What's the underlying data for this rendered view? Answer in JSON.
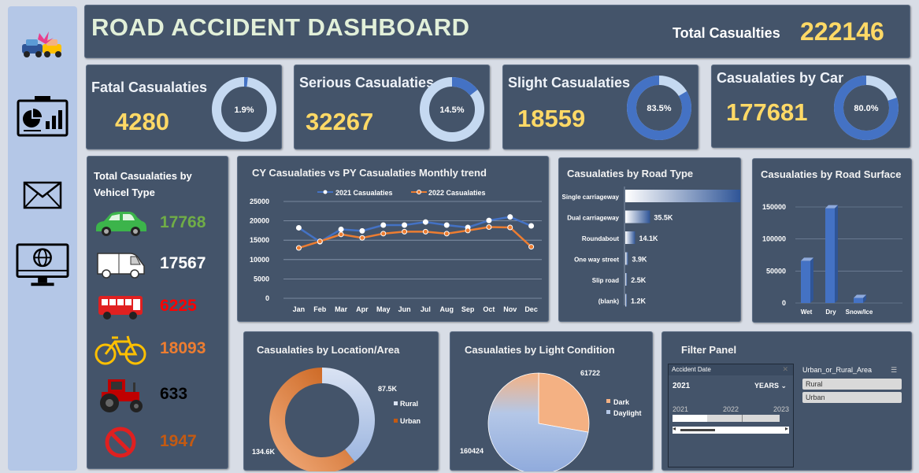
{
  "header": {
    "title": "ROAD ACCIDENT DASHBOARD",
    "total_label": "Total Casualties",
    "total_value": "222146"
  },
  "kpis": [
    {
      "label": "Fatal Casualaties",
      "value": "4280",
      "pct_label": "1.9%",
      "pct": 0.019
    },
    {
      "label": "Serious Casualaties",
      "value": "32267",
      "pct_label": "14.5%",
      "pct": 0.145
    },
    {
      "label": "Slight Casualaties",
      "value": "18559",
      "pct_label": "83.5%",
      "pct": 0.835
    },
    {
      "label": "Casualaties by Car",
      "value": "177681",
      "pct_label": "80.0%",
      "pct": 0.8
    }
  ],
  "vehicle": {
    "title": "Total Casualaties by Vehicel Type",
    "items": [
      {
        "name": "car",
        "value": "17768",
        "color": "#70ad47"
      },
      {
        "name": "van",
        "value": "17567",
        "color": "#ffffff"
      },
      {
        "name": "bus",
        "value": "6225",
        "color": "#ff0000"
      },
      {
        "name": "bicycle",
        "value": "18093",
        "color": "#ed7d31"
      },
      {
        "name": "tractor",
        "value": "633",
        "color": "#000000"
      },
      {
        "name": "other",
        "value": "1947",
        "color": "#c55a11"
      }
    ]
  },
  "trend": {
    "title": "CY Casualaties vs PY Casualaties Monthly trend",
    "legend": [
      "2021 Casualaties",
      "2022 Casualaties"
    ],
    "y_ticks": [
      "25000",
      "20000",
      "15000",
      "10000",
      "5000",
      "0"
    ],
    "months": [
      "Jan",
      "Feb",
      "Mar",
      "Apr",
      "May",
      "Jun",
      "Jul",
      "Aug",
      "Sep",
      "Oct",
      "Nov",
      "Dec"
    ]
  },
  "road_type": {
    "title": "Casualaties by Road Type",
    "rows": [
      {
        "label": "Single carriageway",
        "value": "165.0K"
      },
      {
        "label": "Dual carriageway",
        "value": "35.5K"
      },
      {
        "label": "Roundabout",
        "value": "14.1K"
      },
      {
        "label": "One way street",
        "value": "3.9K"
      },
      {
        "label": "Slip road",
        "value": "2.5K"
      },
      {
        "label": "(blank)",
        "value": "1.2K"
      }
    ]
  },
  "surface": {
    "title": "Casualaties by Road Surface",
    "y_ticks": [
      "150000",
      "100000",
      "50000",
      "0"
    ],
    "categories": [
      "Wet",
      "Dry",
      "Snow/Ice"
    ]
  },
  "location": {
    "title": "Casualaties by Location/Area",
    "rural_label": "87.5K",
    "urban_label": "134.6K",
    "legend": [
      "Rural",
      "Urban"
    ]
  },
  "light": {
    "title": "Casualaties by Light Condition",
    "dark_label": "61722",
    "daylight_label": "160424",
    "legend": [
      "Dark",
      "Daylight"
    ]
  },
  "filter": {
    "title": "Filter Panel",
    "date_header": "Accident Date",
    "year": "2021",
    "years_label": "YEARS",
    "timeline": [
      "2021",
      "2022",
      "2023"
    ],
    "area_header": "Urban_or_Rural_Area",
    "area_options": [
      "Rural",
      "Urban"
    ]
  },
  "chart_data": [
    {
      "type": "line",
      "title": "CY Casualaties vs PY Casualaties Monthly trend",
      "categories": [
        "Jan",
        "Feb",
        "Mar",
        "Apr",
        "May",
        "Jun",
        "Jul",
        "Aug",
        "Sep",
        "Oct",
        "Nov",
        "Dec"
      ],
      "series": [
        {
          "name": "2021 Casualaties",
          "values": [
            18200,
            14600,
            17800,
            17400,
            18900,
            18900,
            19700,
            18900,
            18300,
            20100,
            21000,
            18700
          ],
          "color": "#4472c4"
        },
        {
          "name": "2022 Casualaties",
          "values": [
            13000,
            14700,
            16500,
            15600,
            16700,
            17200,
            17200,
            16700,
            17500,
            18400,
            18300,
            13300
          ],
          "color": "#ed7d31"
        }
      ],
      "ylim": [
        0,
        25000
      ]
    },
    {
      "type": "bar",
      "title": "Casualaties by Road Type",
      "categories": [
        "Single carriageway",
        "Dual carriageway",
        "Roundabout",
        "One way street",
        "Slip road",
        "(blank)"
      ],
      "values": [
        165000,
        35500,
        14100,
        3900,
        2500,
        1200
      ]
    },
    {
      "type": "bar",
      "title": "Casualaties by Road Surface",
      "categories": [
        "Wet",
        "Dry",
        "Snow/Ice"
      ],
      "values": [
        66000,
        148000,
        8000
      ],
      "ylim": [
        0,
        150000
      ]
    },
    {
      "type": "pie",
      "title": "Casualaties by Location/Area",
      "categories": [
        "Rural",
        "Urban"
      ],
      "values": [
        87500,
        134600
      ]
    },
    {
      "type": "pie",
      "title": "Casualaties by Light Condition",
      "categories": [
        "Dark",
        "Daylight"
      ],
      "values": [
        61722,
        160424
      ]
    }
  ]
}
